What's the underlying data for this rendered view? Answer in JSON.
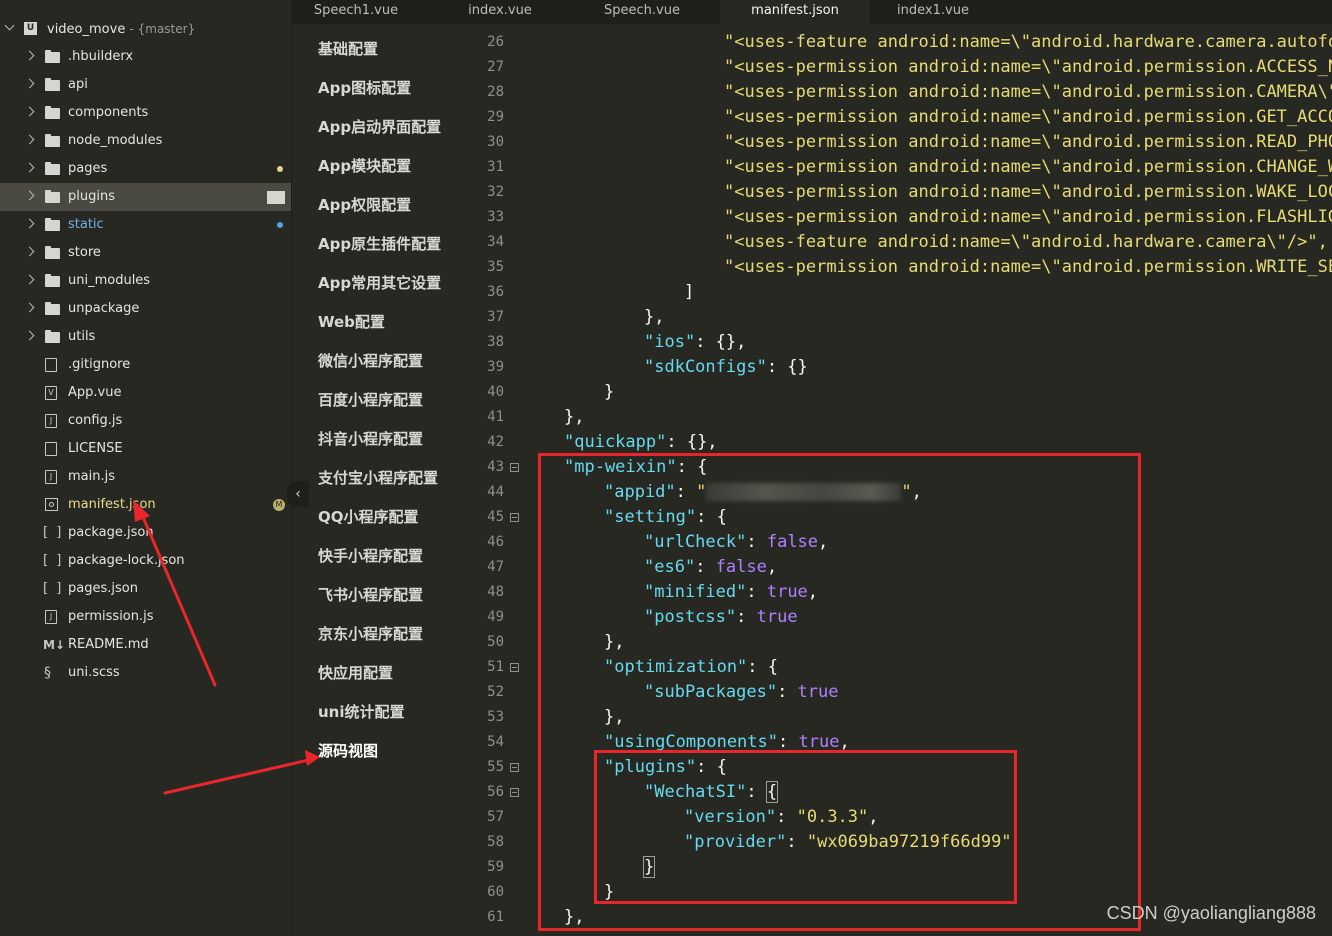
{
  "project": {
    "name": "video_move",
    "branch": "- {master}"
  },
  "file_tree": [
    {
      "label": ".hbuilderx",
      "type": "folder"
    },
    {
      "label": "api",
      "type": "folder"
    },
    {
      "label": "components",
      "type": "folder"
    },
    {
      "label": "node_modules",
      "type": "folder"
    },
    {
      "label": "pages",
      "type": "folder"
    },
    {
      "label": "plugins",
      "type": "folder"
    },
    {
      "label": "static",
      "type": "folder"
    },
    {
      "label": "store",
      "type": "folder"
    },
    {
      "label": "uni_modules",
      "type": "folder"
    },
    {
      "label": "unpackage",
      "type": "folder"
    },
    {
      "label": "utils",
      "type": "folder"
    },
    {
      "label": ".gitignore",
      "type": "file"
    },
    {
      "label": "App.vue",
      "type": "vue"
    },
    {
      "label": "config.js",
      "type": "js"
    },
    {
      "label": "LICENSE",
      "type": "file"
    },
    {
      "label": "main.js",
      "type": "js"
    },
    {
      "label": "manifest.json",
      "type": "manifest"
    },
    {
      "label": "package.json",
      "type": "json"
    },
    {
      "label": "package-lock.json",
      "type": "json"
    },
    {
      "label": "pages.json",
      "type": "json"
    },
    {
      "label": "permission.js",
      "type": "js"
    },
    {
      "label": "README.md",
      "type": "md"
    },
    {
      "label": "uni.scss",
      "type": "scss"
    }
  ],
  "tabs": [
    "Speech1.vue",
    "index.vue",
    "Speech.vue",
    "manifest.json",
    "index1.vue"
  ],
  "settings_menu": [
    "基础配置",
    "App图标配置",
    "App启动界面配置",
    "App模块配置",
    "App权限配置",
    "App原生插件配置",
    "App常用其它设置",
    "Web配置",
    "微信小程序配置",
    "百度小程序配置",
    "抖音小程序配置",
    "支付宝小程序配置",
    "QQ小程序配置",
    "快手小程序配置",
    "飞书小程序配置",
    "京东小程序配置",
    "快应用配置",
    "uni统计配置",
    "源码视图"
  ],
  "line_numbers": [
    "26",
    "27",
    "28",
    "29",
    "30",
    "31",
    "32",
    "33",
    "34",
    "35",
    "36",
    "37",
    "38",
    "39",
    "40",
    "41",
    "42",
    "43",
    "44",
    "45",
    "46",
    "47",
    "48",
    "49",
    "50",
    "51",
    "52",
    "53",
    "54",
    "55",
    "56",
    "57",
    "58",
    "59",
    "60",
    "61"
  ],
  "code": {
    "l26": "\"<uses-feature android:name=\\\"android.hardware.camera.autofoc",
    "l27": "\"<uses-permission android:name=\\\"android.permission.ACCESS_NE",
    "l28": "\"<uses-permission android:name=\\\"android.permission.CAMERA\\\"/",
    "l29": "\"<uses-permission android:name=\\\"android.permission.GET_ACCOU",
    "l30": "\"<uses-permission android:name=\\\"android.permission.READ_PHON",
    "l31": "\"<uses-permission android:name=\\\"android.permission.CHANGE_WI",
    "l32": "\"<uses-permission android:name=\\\"android.permission.WAKE_LOCK",
    "l33": "\"<uses-permission android:name=\\\"android.permission.FLASHLIGH",
    "l34": "\"<uses-feature android:name=\\\"android.hardware.camera\\\"/>\",",
    "l35": "\"<uses-permission android:name=\\\"android.permission.WRITE_SET",
    "k_ios": "\"ios\"",
    "k_sdk": "\"sdkConfigs\"",
    "k_quickapp": "\"quickapp\"",
    "k_mpweixin": "\"mp-weixin\"",
    "k_appid": "\"appid\"",
    "k_setting": "\"setting\"",
    "k_urlcheck": "\"urlCheck\"",
    "k_es6": "\"es6\"",
    "k_minified": "\"minified\"",
    "k_postcss": "\"postcss\"",
    "k_optimization": "\"optimization\"",
    "k_subpackages": "\"subPackages\"",
    "k_usingcomponents": "\"usingComponents\"",
    "k_plugins": "\"plugins\"",
    "k_wechatsi": "\"WechatSI\"",
    "k_version": "\"version\"",
    "k_provider": "\"provider\"",
    "v_version": "\"0.3.3\"",
    "v_provider": "\"wx069ba97219f66d99\"",
    "v_false": "false",
    "v_true": "true"
  },
  "watermark": "CSDN @yaoliangliang888",
  "colors": {
    "annotation_red": "#e8262b",
    "string_yellow": "#e6db74",
    "boolean_purple": "#ae81ff"
  }
}
